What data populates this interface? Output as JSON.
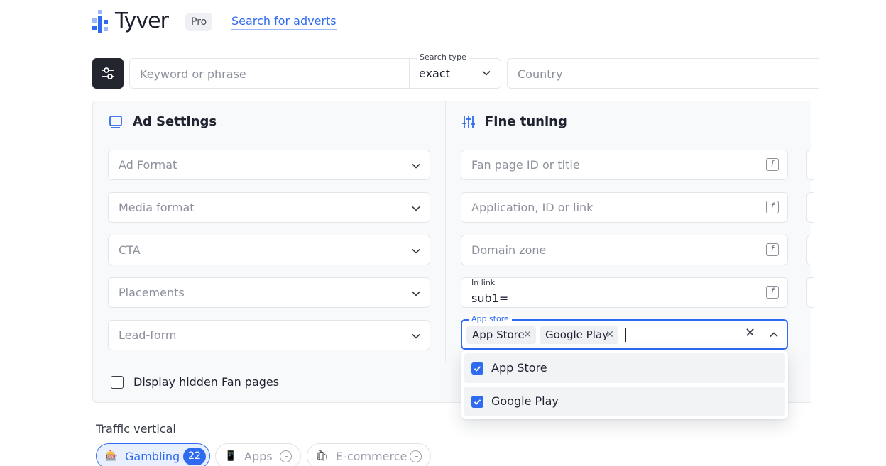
{
  "header": {
    "brand": "Tyver",
    "badge": "Pro",
    "nav_link": "Search for adverts"
  },
  "search": {
    "keyword_placeholder": "Keyword or phrase",
    "type_label": "Search type",
    "type_value": "exact",
    "country_placeholder": "Country"
  },
  "ad_settings": {
    "title": "Ad Settings",
    "fields": [
      "Ad Format",
      "Media format",
      "CTA",
      "Placements",
      "Lead-form"
    ]
  },
  "fine_tuning": {
    "title": "Fine tuning",
    "fan_page_placeholder": "Fan page ID or title",
    "application_placeholder": "Application, ID or link",
    "domain_placeholder": "Domain zone",
    "in_link_label": "In link",
    "in_link_value": "sub1=",
    "app_store_label": "App store",
    "app_store_chips": [
      "App Store",
      "Google Play"
    ],
    "app_store_options": [
      {
        "label": "App Store",
        "checked": true
      },
      {
        "label": "Google Play",
        "checked": true
      }
    ]
  },
  "hidden_fan_pages": {
    "label": "Display hidden Fan pages",
    "checked": false
  },
  "traffic_vertical": {
    "label": "Traffic vertical",
    "options": [
      {
        "label": "Gambling",
        "count": "22",
        "active": true
      },
      {
        "label": "Apps",
        "active": false
      },
      {
        "label": "E-commerce",
        "active": false
      }
    ]
  },
  "colors": {
    "accent": "#2f6bf0",
    "dark_button": "#23262f",
    "panel_bg": "#f8f9fb"
  }
}
